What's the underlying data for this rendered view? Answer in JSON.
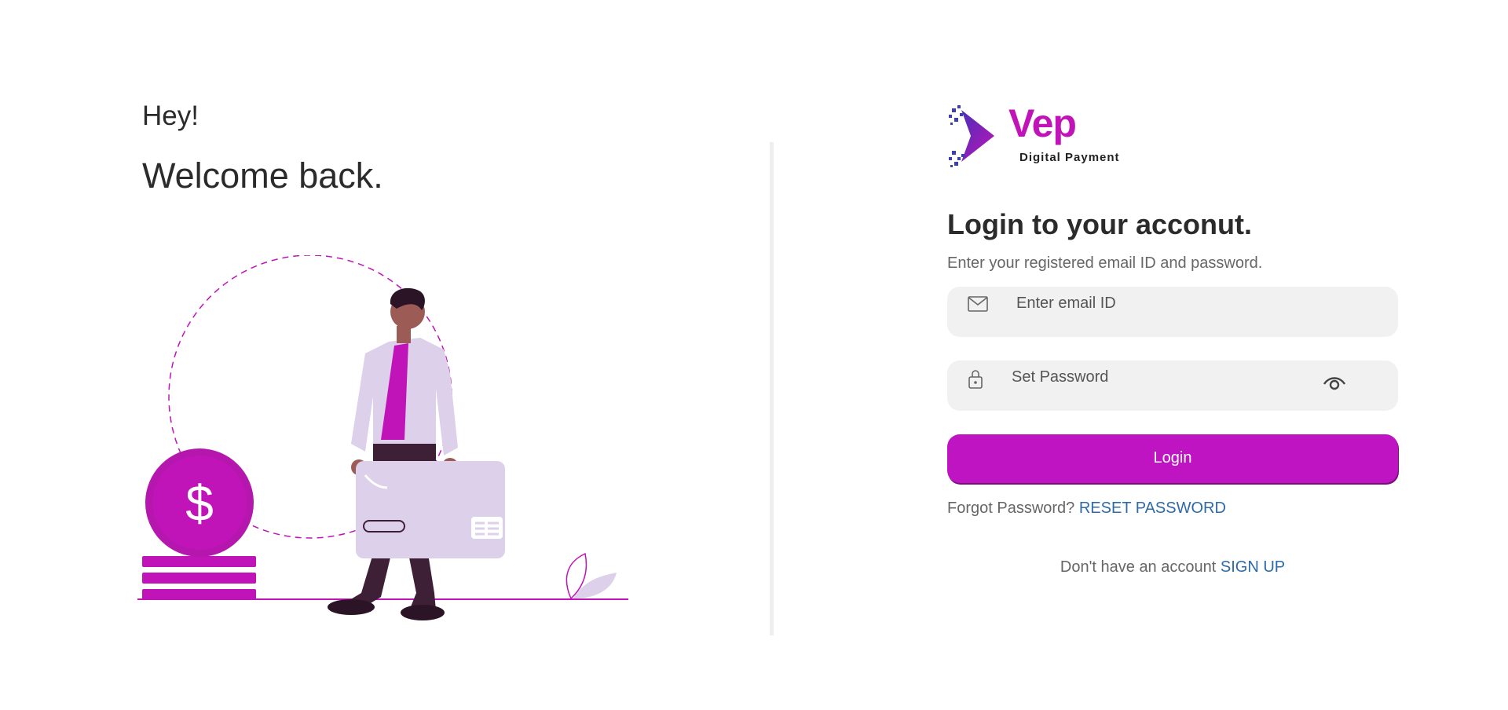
{
  "hero": {
    "greeting": "Hey!",
    "welcome": "Welcome back."
  },
  "illustration": {
    "coin_symbol": "$"
  },
  "brand": {
    "name": "Vep",
    "tagline": "Digital Payment",
    "color": "#c014b8"
  },
  "login": {
    "title": "Login to your acconut.",
    "subtitle": "Enter your registered email ID and password.",
    "email_placeholder": "Enter email ID",
    "email_icon": "mail-icon",
    "password_placeholder": "Set Password",
    "password_icon": "lock-icon",
    "show_password_icon": "eye-icon",
    "button_label": "Login",
    "button_color": "#be14c2"
  },
  "forgot": {
    "text": "Forgot Password?",
    "link": "RESET PASSWORD"
  },
  "signup": {
    "text": "Don't have an account",
    "link": "SIGN UP"
  },
  "colors": {
    "link": "#2e6aa8",
    "accent": "#c014b8"
  }
}
